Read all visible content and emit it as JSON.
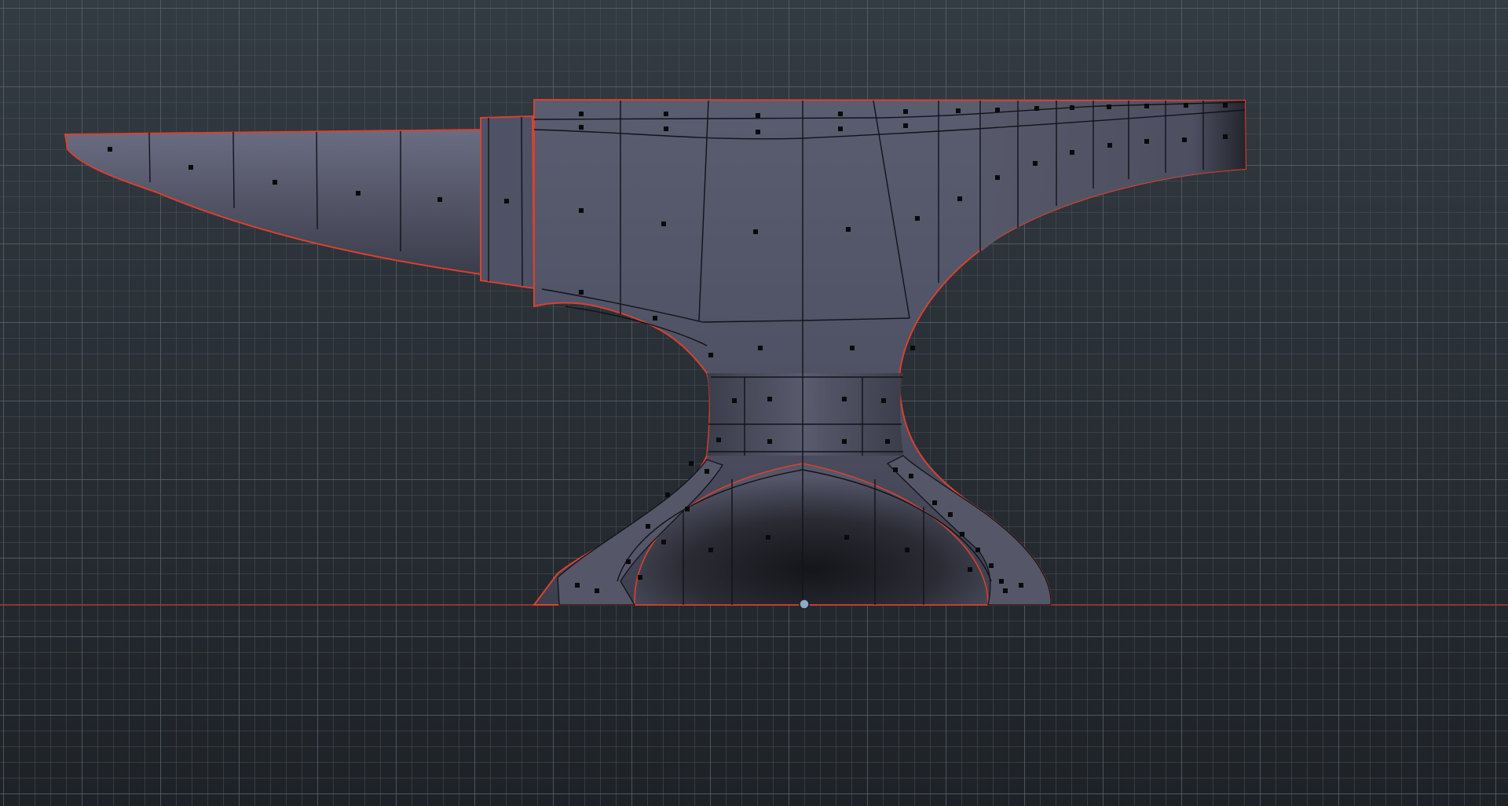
{
  "viewport": {
    "mode": "side-orthographic",
    "background": {
      "top": "#333b43",
      "bottom": "#1e2227"
    },
    "grid": {
      "visible": true,
      "minor_color": "#4a535c",
      "major_color": "#5d6771"
    },
    "ground_axis": {
      "visible": true,
      "color": "#b03a30"
    }
  },
  "model": {
    "object": "anvil",
    "selected": true,
    "selection_outline_color": "#d9412f",
    "mesh_fill": "#5c5e72",
    "mesh_fill_dark": "#24252c",
    "edge_color": "#121318",
    "face_dot_color": "#0a0a0a"
  },
  "pivot": {
    "visible": true,
    "color": "#8fa8c8"
  }
}
